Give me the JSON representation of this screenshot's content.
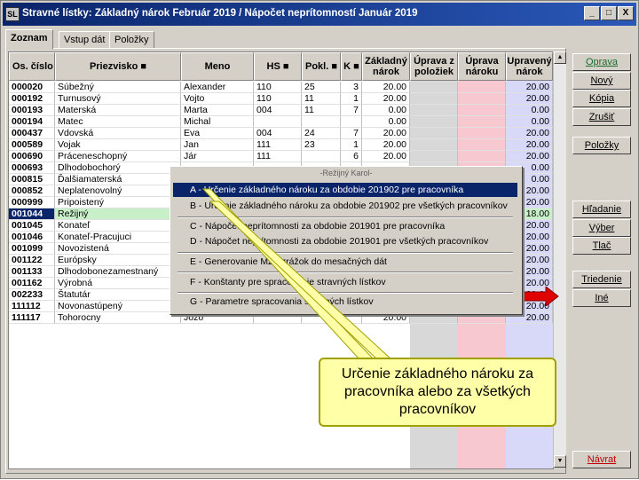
{
  "window": {
    "title": "Stravné lístky:  Základný nárok Február 2019  /  Nápočet neprítomností Január 2019",
    "controls": [
      "_",
      "□",
      "X"
    ]
  },
  "tabs": [
    "Zoznam",
    "Vstup dát",
    "Položky"
  ],
  "columns": [
    "Os. číslo",
    "Priezvisko ■",
    "Meno",
    "HS ■",
    "Pokl. ■",
    "K ■",
    "Základný nárok",
    "Úprava z položiek",
    "Úprava nároku",
    "Upravený nárok"
  ],
  "rows": [
    {
      "id": "000020",
      "surname": "Súbežný",
      "name": "Alexander",
      "hs": "110",
      "pokl": "25",
      "k": "3",
      "base": "20.00",
      "adj": "20.00"
    },
    {
      "id": "000192",
      "surname": "Turnusový",
      "name": "Vojto",
      "hs": "110",
      "pokl": "11",
      "k": "1",
      "base": "20.00",
      "adj": "20.00"
    },
    {
      "id": "000193",
      "surname": "Materská",
      "name": "Marta",
      "hs": "004",
      "pokl": "11",
      "k": "7",
      "base": "0.00",
      "adj": "0.00"
    },
    {
      "id": "000194",
      "surname": "Matec",
      "name": "Michal",
      "hs": "",
      "pokl": "",
      "k": "",
      "base": "0.00",
      "adj": "0.00"
    },
    {
      "id": "000437",
      "surname": "Vdovská",
      "name": "Eva",
      "hs": "004",
      "pokl": "24",
      "k": "7",
      "base": "20.00",
      "adj": "20.00"
    },
    {
      "id": "000589",
      "surname": "Vojak",
      "name": "Jan",
      "hs": "111",
      "pokl": "23",
      "k": "1",
      "base": "20.00",
      "adj": "20.00"
    },
    {
      "id": "000690",
      "surname": "Práceneschopný",
      "name": "Jár",
      "hs": "111",
      "pokl": "",
      "k": "6",
      "base": "20.00",
      "adj": "20.00"
    },
    {
      "id": "000693",
      "surname": "Dlhodobochorý",
      "name": "",
      "hs": "",
      "pokl": "",
      "k": "",
      "base": "",
      "adj": "0.00"
    },
    {
      "id": "000815",
      "surname": "Ďalšiamaterská",
      "name": "",
      "hs": "",
      "pokl": "",
      "k": "",
      "base": "",
      "adj": "0.00"
    },
    {
      "id": "000852",
      "surname": "Neplatenovolný",
      "name": "",
      "hs": "",
      "pokl": "",
      "k": "",
      "base": "",
      "adj": "20.00"
    },
    {
      "id": "000999",
      "surname": "Pripoistený",
      "name": "",
      "hs": "",
      "pokl": "",
      "k": "",
      "base": "",
      "adj": "20.00"
    },
    {
      "id": "001044",
      "surname": "Režijný",
      "name": "",
      "hs": "",
      "pokl": "",
      "k": "",
      "base": "",
      "adj": "18.00"
    },
    {
      "id": "001045",
      "surname": "Konateľ",
      "name": "",
      "hs": "",
      "pokl": "",
      "k": "",
      "base": "",
      "adj": "20.00"
    },
    {
      "id": "001046",
      "surname": "Konateľ-Pracujuci",
      "name": "",
      "hs": "",
      "pokl": "",
      "k": "",
      "base": "",
      "adj": "20.00"
    },
    {
      "id": "001099",
      "surname": "Novozistená",
      "name": "",
      "hs": "",
      "pokl": "",
      "k": "",
      "base": "",
      "adj": "20.00"
    },
    {
      "id": "001122",
      "surname": "Európsky",
      "name": "",
      "hs": "",
      "pokl": "",
      "k": "",
      "base": "",
      "adj": "20.00"
    },
    {
      "id": "001133",
      "surname": "Dlhodobonezamestnaný",
      "name": "",
      "hs": "",
      "pokl": "",
      "k": "",
      "base": "",
      "adj": "20.00"
    },
    {
      "id": "001162",
      "surname": "Výrobná",
      "name": "",
      "hs": "",
      "pokl": "",
      "k": "",
      "base": "",
      "adj": "20.00"
    },
    {
      "id": "002233",
      "surname": "Štatutár",
      "name": "Benjamín",
      "hs": "",
      "pokl": "",
      "k": "",
      "base": "20.00",
      "adj": "20.00"
    },
    {
      "id": "111112",
      "surname": "Novonastúpený",
      "name": "Jano",
      "hs": "110",
      "pokl": "",
      "k": "",
      "base": "20.00",
      "adj": "20.00"
    },
    {
      "id": "111117",
      "surname": "Tohorocny",
      "name": "Jozo",
      "hs": "",
      "pokl": "",
      "k": "",
      "base": "20.00",
      "adj": "20.00"
    }
  ],
  "right_buttons": [
    "Oprava",
    "Nový",
    "Kópia",
    "Zrušiť",
    "Položky",
    "Hľadanie",
    "Výber",
    "Tlač",
    "Triedenie",
    "Iné",
    "Návrat"
  ],
  "menu": {
    "title": "-Režijný Karol-",
    "items": [
      "A - Určenie základného nároku za obdobie 201902 pre pracovníka",
      "B - Určenie základného nároku za obdobie 201902 pre všetkých pracovníkov",
      "C - Nápočet neprítomnosti za obdobie 201901 pre pracovníka",
      "D - Nápočet neprítomnosti za obdobie 201901 pre všetkých pracovníkov",
      "E - Generovanie MZL zrážok do mesačných dát",
      "F - Konštanty pre spracovanie stravných lístkov",
      "G - Parametre spracovania stravných lístkov"
    ]
  },
  "callout": "Určenie základného nároku za pracovníka alebo za všetkých pracovníkov",
  "colors": {
    "title_bar": "#0a246a",
    "adj_col": "#f8c8d0",
    "base_col": "#d8d8d8",
    "result_col": "#d8d8f8",
    "highlight_row": "#c8f0c8",
    "arrow": "#e00000"
  }
}
